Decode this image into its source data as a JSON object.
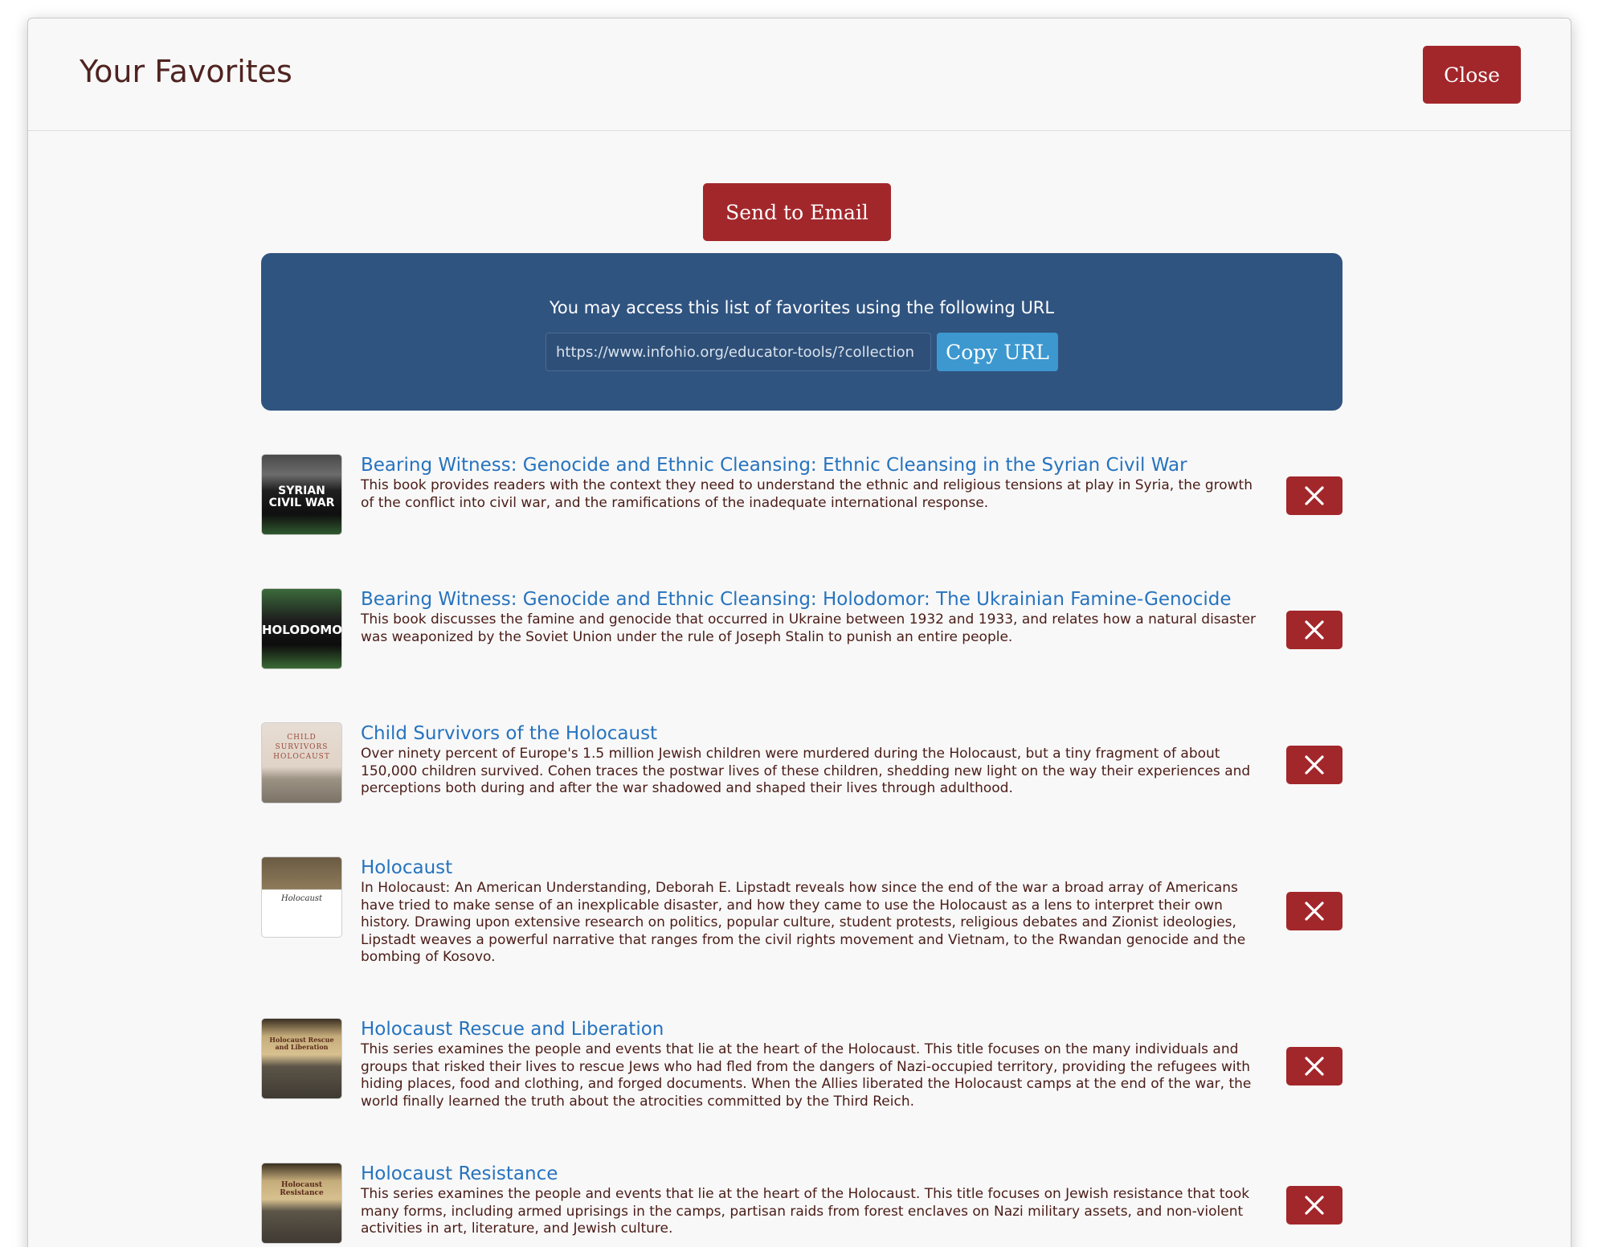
{
  "modal": {
    "title": "Your Favorites",
    "close_label": "Close"
  },
  "actions": {
    "send_email_label": "Send to Email"
  },
  "url_panel": {
    "label": "You may access this list of favorites using the following URL",
    "url_value": "https://www.infohio.org/educator-tools/?collection",
    "copy_label": "Copy URL"
  },
  "colors": {
    "brand_red": "#a2272b",
    "panel_blue": "#305480",
    "copy_blue": "#3c98cf",
    "link_blue": "#2673bf"
  },
  "favorites": [
    {
      "title": "Bearing Witness: Genocide and Ethnic Cleansing: Ethnic Cleansing in the Syrian Civil War",
      "description": "This book provides readers with the context they need to understand the ethnic and religious tensions at play in Syria, the growth of the conflict into civil war, and the ramifications of the inadequate international response.",
      "cover_text": "SYRIAN CIVIL WAR",
      "remove_icon": "close-icon"
    },
    {
      "title": "Bearing Witness: Genocide and Ethnic Cleansing: Holodomor: The Ukrainian Famine-Genocide",
      "description": "This book discusses the famine and genocide that occurred in Ukraine between 1932 and 1933, and relates how a natural disaster was weaponized by the Soviet Union under the rule of Joseph Stalin to punish an entire people.",
      "cover_text": "HOLODOMOR",
      "remove_icon": "close-icon"
    },
    {
      "title": "Child Survivors of the Holocaust",
      "description": "Over ninety percent of Europe's 1.5 million Jewish children were murdered during the Holocaust, but a tiny fragment of about 150,000 children survived. Cohen traces the postwar lives of these children, shedding new light on the way their experiences and perceptions both during and after the war shadowed and shaped their lives through adulthood.",
      "cover_text": "CHILD SURVIVORS HOLOCAUST",
      "remove_icon": "close-icon"
    },
    {
      "title": "Holocaust",
      "description": "In Holocaust: An American Understanding, Deborah E. Lipstadt reveals how since the end of the war a broad array of Americans have tried to make sense of an inexplicable disaster, and how they came to use the Holocaust as a lens to interpret their own history. Drawing upon extensive research on politics, popular culture, student protests, religious debates and Zionist ideologies, Lipstadt weaves a powerful narrative that ranges from the civil rights movement and Vietnam, to the Rwandan genocide and the bombing of Kosovo.",
      "cover_text": "Holocaust",
      "remove_icon": "close-icon"
    },
    {
      "title": "Holocaust Rescue and Liberation",
      "description": "This series examines the people and events that lie at the heart of the Holocaust. This title focuses on the many individuals and groups that risked their lives to rescue Jews who had fled from the dangers of Nazi-occupied territory, providing the refugees with hiding places, food and clothing, and forged documents. When the Allies liberated the Holocaust camps at the end of the war, the world finally learned the truth about the atrocities committed by the Third Reich.",
      "cover_text": "Holocaust Rescue and Liberation",
      "remove_icon": "close-icon"
    },
    {
      "title": "Holocaust Resistance",
      "description": "This series examines the people and events that lie at the heart of the Holocaust. This title focuses on Jewish resistance that took many forms, including armed uprisings in the camps, partisan raids from forest enclaves on Nazi military assets, and non-violent activities in art, literature, and Jewish culture.",
      "cover_text": "Holocaust Resistance",
      "remove_icon": "close-icon"
    }
  ]
}
